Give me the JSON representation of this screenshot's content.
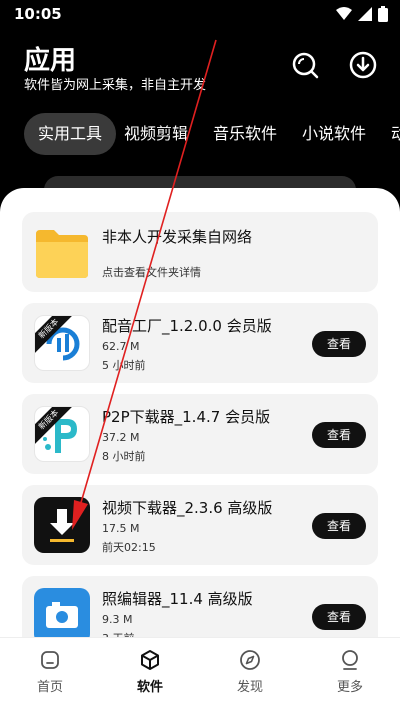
{
  "status": {
    "time": "10:05"
  },
  "header": {
    "title": "应用",
    "subtitle": "软件皆为网上采集，非自主开发"
  },
  "tabs": [
    {
      "label": "实用工具"
    },
    {
      "label": "视频剪辑"
    },
    {
      "label": "音乐软件"
    },
    {
      "label": "小说软件"
    },
    {
      "label": "动"
    }
  ],
  "folder_card": {
    "title": "非本人开发采集自网络",
    "hint": "点击查看文件夹详情"
  },
  "apps": [
    {
      "title": "配音工厂_1.2.0.0 会员版",
      "size": "62.7 M",
      "time": "5 小时前",
      "badge": "新版本",
      "button": "查看"
    },
    {
      "title": "P2P下载器_1.4.7 会员版",
      "size": "37.2 M",
      "time": "8 小时前",
      "badge": "新版本",
      "button": "查看"
    },
    {
      "title": "视频下载器_2.3.6 高级版",
      "size": "17.5 M",
      "time": "前天02:15",
      "button": "查看"
    },
    {
      "title": "照编辑器_11.4 高级版",
      "size": "9.3 M",
      "time": "3 天前",
      "button": "查看"
    }
  ],
  "tabbar": [
    {
      "label": "首页"
    },
    {
      "label": "软件"
    },
    {
      "label": "发现"
    },
    {
      "label": "更多"
    }
  ],
  "colors": {
    "accent": "#111111",
    "annotation": "#e02020",
    "card_bg": "#f3f3f3"
  }
}
